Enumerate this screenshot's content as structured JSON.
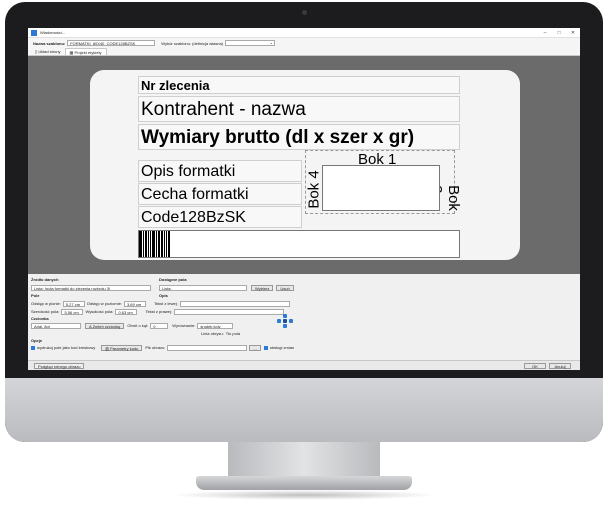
{
  "window": {
    "title": "Wiadomości...",
    "minimize": "–",
    "maximize": "□",
    "close": "✕"
  },
  "form": {
    "template_name_label": "Nazwa szablonu:",
    "template_name_value": "FORMATKI_60X40_CODE128BZSK",
    "source_label": "Wybór szablonu: (definicja własna)",
    "source_value": ""
  },
  "tabs": [
    {
      "label": "Układ strony"
    },
    {
      "label": "Projekt etykiety"
    }
  ],
  "label": {
    "order_no": "Nr zlecenia",
    "contractor": "Kontrahent - nazwa",
    "dimensions": "Wymiary brutto (dl x szer x gr)",
    "description": "Opis formatki",
    "feature": "Cecha formatki",
    "barcode_type": "Code128BzSK",
    "side1": "Bok 1",
    "side2": "Bok 2",
    "side4": "Bok 4"
  },
  "barcode_bars": [
    3,
    1,
    2,
    1,
    1,
    3,
    1,
    2,
    2,
    1,
    1,
    2
  ],
  "panel": {
    "data_source_label": "Źródło danych",
    "data_source_value": "Lista: (pola formatki do zlecenia rozkroju 3)",
    "available_fields_label": "Dostępne pola",
    "available_fields_value": "Lista:",
    "choose_button": "Wybierz",
    "remove_button": "Usuń",
    "field_section": "Pole",
    "desc_section": "Opis",
    "left_offset_label": "Odstęp w pionie:",
    "left_offset_value": "5,27 cm",
    "top_offset_label": "Odstęp w poziomie:",
    "top_offset_value": "3,69 cm",
    "width_label": "Szerokość pola:",
    "width_value": "5,56 cm",
    "height_label": "Wysokość pola:",
    "height_value": "0,63 cm",
    "text_left_label": "Tekst z lewej:",
    "text_right_label": "Tekst z prawej:",
    "font_section": "Czcionka",
    "font_value": "Arial, 8pt",
    "font_button": "Zmień czcionkę",
    "rotation_label": "Obrót o kąt:",
    "rotation_value": "0",
    "align_label": "Wyrównanie:",
    "align_value": "środek kolv",
    "border_label": "Linia obrysu:",
    "border_value": "Tło pola",
    "options_section": "Opcje",
    "print_as_barcode": "wydrukuj pole jako kod kreskowy",
    "barcode_params_button": "Parametry kodu",
    "prefix_label": "Pik obrazu:",
    "browse_button": "...",
    "allow_change": "obsługi zmian"
  },
  "status": {
    "left": "Podgląd rolnego obrazu",
    "ok": "OK",
    "cancel": "Anuluj"
  }
}
